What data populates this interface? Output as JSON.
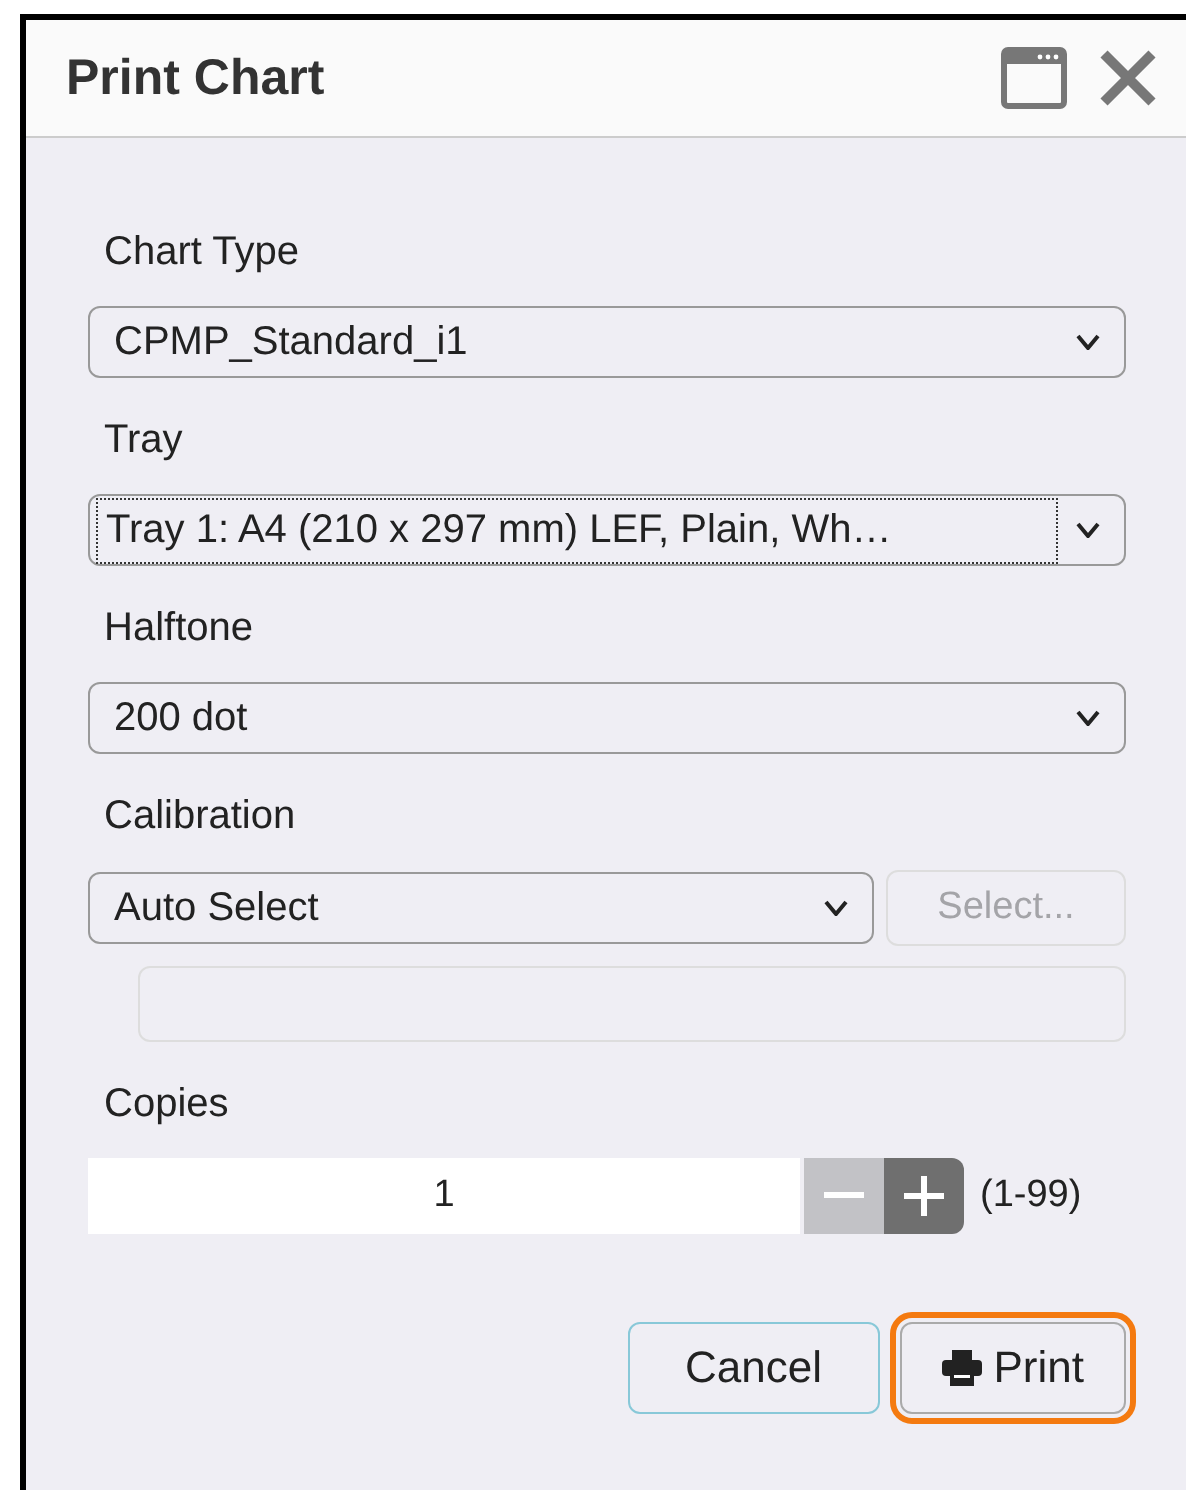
{
  "window": {
    "title": "Print Chart"
  },
  "fields": [
    {
      "kind": "select",
      "label": "Chart Type",
      "value": "CPMP_Standard_i1",
      "focused": false
    },
    {
      "kind": "select",
      "label": "Tray",
      "value": "Tray 1: A4 (210 x 297 mm) LEF, Plain, Wh…",
      "focused": true
    },
    {
      "kind": "select",
      "label": "Halftone",
      "value": "200 dot",
      "focused": false
    },
    {
      "kind": "select_with_button",
      "label": "Calibration",
      "value": "Auto Select",
      "focused": false,
      "button": {
        "label": "Select...",
        "disabled": true
      },
      "extra_field": {
        "disabled": true
      }
    },
    {
      "kind": "stepper",
      "label": "Copies",
      "value": "1",
      "range": "(1-99)",
      "minus_disabled": true
    }
  ],
  "buttons": [
    {
      "label": "Cancel",
      "kind": "cancel",
      "focused": false
    },
    {
      "label": "Print",
      "kind": "print",
      "focused": true
    }
  ]
}
